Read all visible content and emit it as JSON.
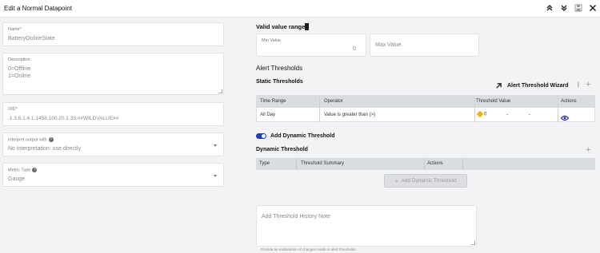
{
  "window": {
    "title": "Edit a Normal Datapoint"
  },
  "toolbar": {
    "icons": [
      "double-chevron-up-icon",
      "double-chevron-down-icon",
      "save-icon",
      "close-icon"
    ]
  },
  "left": {
    "name": {
      "label": "Name*",
      "value": "BatteryOnlineState"
    },
    "description": {
      "label": "Description",
      "line1": "0=Offline",
      "line2": "1=Online"
    },
    "oid": {
      "label": "OID*",
      "value": ".1.3.6.1.4.1.1458.100.20.1.33.##WILDVALUE##"
    },
    "interpret": {
      "label": "Interpret output with",
      "value": "No interpretation: use directly"
    },
    "metric_type": {
      "label": "Metric Type",
      "value": "Gauge"
    }
  },
  "right": {
    "valid_range": {
      "title": "Valid value range",
      "min_label": "Min Value",
      "min_value": "0",
      "max_placeholder": "Max Value"
    },
    "alert_title": "Alert Thresholds",
    "static": {
      "title": "Static Thresholds",
      "wizard_label": "Alert Threshold Wizard",
      "separator": "|",
      "columns": [
        "Time Range",
        "Operator",
        "Threshold Value",
        "Actions"
      ],
      "row": {
        "time_range": "All Day",
        "operator": "Value is greater than (>)",
        "threshold": "0",
        "dash1": "-",
        "dash2": "-"
      }
    },
    "dynamic_toggle_label": "Add Dynamic Threshold",
    "dynamic": {
      "title": "Dynamic Threshold",
      "columns": [
        "Type",
        "Threshold Summary",
        "Actions"
      ],
      "add_button": "Add Dynamic Threshold"
    },
    "history": {
      "placeholder": "Add Threshold History Note",
      "help": "Provide an explanation of changes made to alert thresholds."
    }
  }
}
